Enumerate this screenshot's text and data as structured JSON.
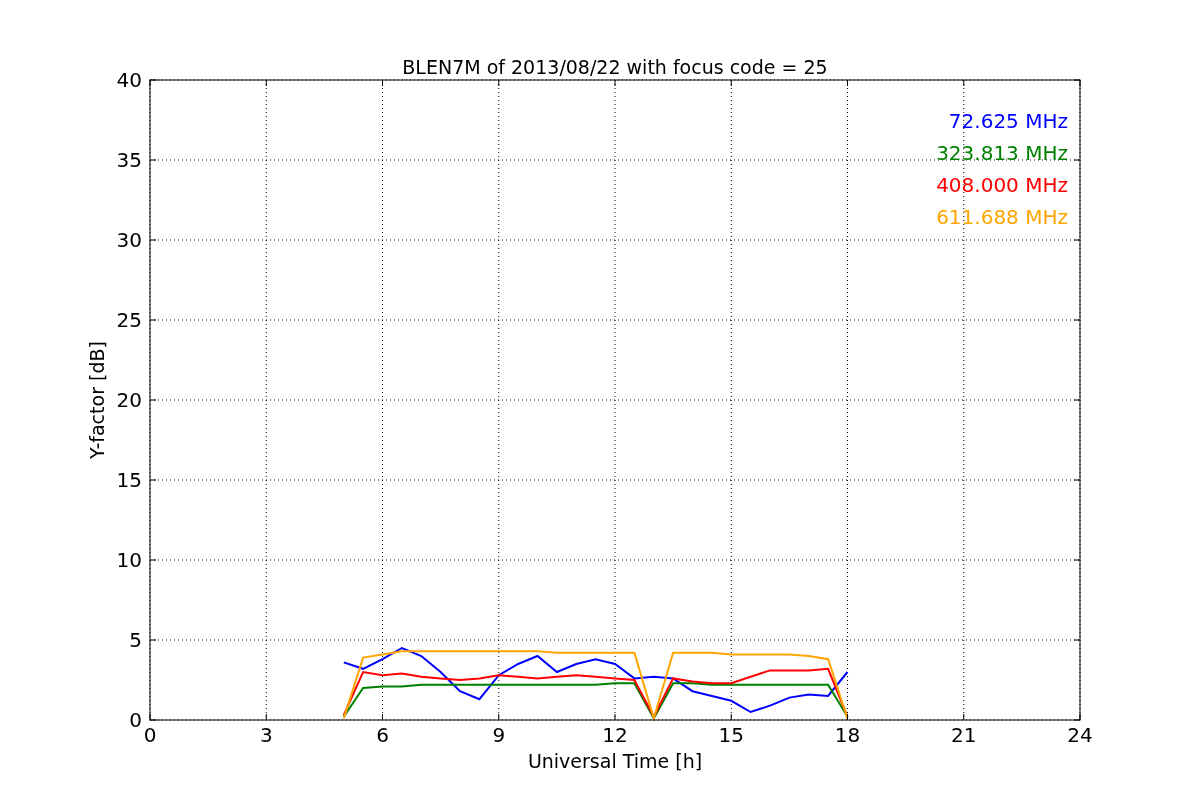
{
  "figure": {
    "chart_data": {
      "type": "line",
      "title": "BLEN7M of 2013/08/22 with focus code = 25",
      "xlabel": "Universal Time [h]",
      "ylabel": "Y-factor [dB]",
      "x": [
        5,
        5.5,
        6,
        6.5,
        7,
        7.5,
        8,
        8.5,
        9,
        9.5,
        10,
        10.5,
        11,
        11.5,
        12,
        12.5,
        13,
        13.5,
        14,
        14.5,
        15,
        15.5,
        16,
        16.5,
        17,
        17.5,
        18
      ],
      "series": [
        {
          "name": "72.625 MHz",
          "color": "#0000ff",
          "values": [
            3.6,
            3.2,
            3.8,
            4.5,
            4.0,
            3.0,
            1.8,
            1.3,
            2.8,
            3.5,
            4.0,
            3.0,
            3.5,
            3.8,
            3.5,
            2.6,
            2.7,
            2.6,
            1.8,
            1.5,
            1.2,
            0.5,
            0.9,
            1.4,
            1.6,
            1.5,
            3.0
          ]
        },
        {
          "name": "323.813 MHz",
          "color": "#008000",
          "values": [
            0.2,
            2.0,
            2.1,
            2.1,
            2.2,
            2.2,
            2.2,
            2.2,
            2.2,
            2.2,
            2.2,
            2.2,
            2.2,
            2.2,
            2.3,
            2.3,
            0.1,
            2.3,
            2.3,
            2.2,
            2.2,
            2.2,
            2.2,
            2.2,
            2.2,
            2.2,
            0.2
          ]
        },
        {
          "name": "408.000 MHz",
          "color": "#ff0000",
          "values": [
            0.3,
            3.0,
            2.8,
            2.9,
            2.7,
            2.6,
            2.5,
            2.6,
            2.8,
            2.7,
            2.6,
            2.7,
            2.8,
            2.7,
            2.6,
            2.5,
            0.2,
            2.6,
            2.4,
            2.3,
            2.3,
            2.7,
            3.1,
            3.1,
            3.1,
            3.2,
            0.2
          ]
        },
        {
          "name": "611.688 MHz",
          "color": "#ffa500",
          "values": [
            0.1,
            3.9,
            4.1,
            4.3,
            4.3,
            4.3,
            4.3,
            4.3,
            4.3,
            4.3,
            4.3,
            4.2,
            4.2,
            4.2,
            4.2,
            4.2,
            0.1,
            4.2,
            4.2,
            4.2,
            4.1,
            4.1,
            4.1,
            4.1,
            4.0,
            3.8,
            0.1
          ]
        }
      ],
      "grid": true,
      "xlim": [
        0,
        24
      ],
      "ylim": [
        0,
        40
      ],
      "xticks": [
        0,
        3,
        6,
        9,
        12,
        15,
        18,
        21,
        24
      ],
      "yticks": [
        0,
        5,
        10,
        15,
        20,
        25,
        30,
        35,
        40
      ]
    }
  }
}
